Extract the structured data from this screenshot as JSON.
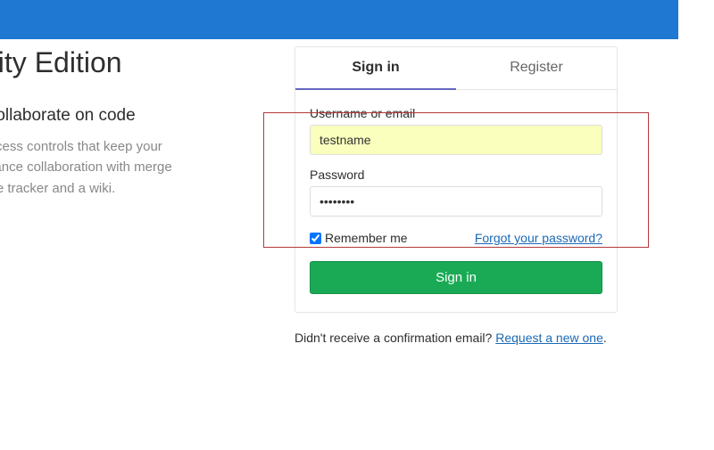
{
  "left": {
    "title": "nity Edition",
    "subtitle": "o collaborate on code",
    "desc_line1": "-grained access controls that keep your",
    "desc_line2": "vs and enhance collaboration with merge",
    "desc_line3": "ave an issue tracker and a wiki."
  },
  "tabs": {
    "signin": "Sign in",
    "register": "Register"
  },
  "form": {
    "username_label": "Username or email",
    "username_value": "testname",
    "password_label": "Password",
    "password_value": "••••••••",
    "remember_label": "Remember me",
    "forgot_label": "Forgot your password?",
    "submit_label": "Sign in"
  },
  "below": {
    "text": "Didn't receive a confirmation email? ",
    "link": "Request a new one",
    "dot": "."
  }
}
